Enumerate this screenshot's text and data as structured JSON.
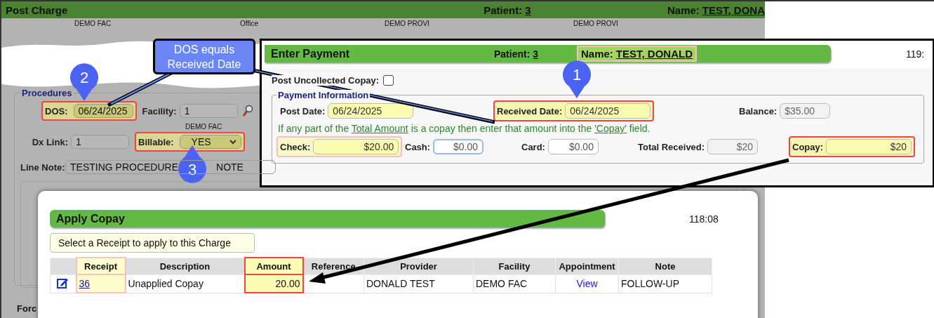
{
  "post_charge": {
    "title": "Post Charge",
    "patient_label": "Patient:",
    "patient": "3",
    "name_label": "Name:",
    "name": "TEST, DONA",
    "top_labels": [
      "DEMO FAC",
      "Office",
      "DEMO PROVI",
      "DEMO PROVI"
    ],
    "procedures": {
      "legend": "Procedures",
      "dos": {
        "label": "DOS:",
        "value": "06/24/2025",
        "highlighted": true
      },
      "facility": {
        "label": "Facility:",
        "value": "1"
      },
      "facility_name": "DEMO FAC",
      "dx_link": {
        "label": "Dx Link:",
        "value": "1"
      },
      "billable": {
        "label": "Billable:",
        "value": "YES",
        "highlighted": true
      },
      "line_note": {
        "label": "Line Note:",
        "value": "TESTING PROCEDURE",
        "value_after_marker": "NOTE"
      }
    },
    "footer_label": "Forc"
  },
  "enter_payment": {
    "title": "Enter Payment",
    "patient_label": "Patient:",
    "patient": "3",
    "name_label": "Name:",
    "name": "TEST, DONALD",
    "name_soft_highlighted": true,
    "timer": "119:",
    "uncollected": {
      "label": "Post Uncollected Copay:",
      "checked": false
    },
    "legend": "Payment Information",
    "row1": [
      {
        "label": "Post Date:",
        "value": "06/24/2025",
        "required": true
      },
      {
        "label": "Received Date:",
        "value": "06/24/2025",
        "required": true,
        "highlighted": true
      },
      {
        "label": "Balance:",
        "value": "$35.00",
        "disabled": true
      }
    ],
    "message": [
      {
        "kind": "text",
        "text": "If any part of the "
      },
      {
        "kind": "link",
        "text": "Total Amount"
      },
      {
        "kind": "text",
        "text": " is a copay then enter that amount into the "
      },
      {
        "kind": "link",
        "text": "'Copay'"
      },
      {
        "kind": "text",
        "text": " field."
      }
    ],
    "row2": [
      {
        "label": "Check:",
        "value": "$20.00",
        "required": true,
        "soft_highlighted": true
      },
      {
        "label": "Cash:",
        "value": "$0.00",
        "focused": true
      },
      {
        "label": "Card:",
        "value": "$0.00"
      },
      {
        "label": "Total Received:",
        "value": "$20",
        "disabled": true
      },
      {
        "label": "Copay:",
        "value": "$20",
        "required": true,
        "highlighted": true
      }
    ]
  },
  "apply_copay": {
    "title": "Apply Copay",
    "timer": "118:08",
    "select_button": "Select a Receipt to apply to this Charge",
    "columns": [
      {
        "label": "Receipt",
        "soft_highlighted": true
      },
      {
        "label": "Description"
      },
      {
        "label": "Amount",
        "highlighted": true
      },
      {
        "label": "Reference"
      },
      {
        "label": "Provider"
      },
      {
        "label": "Facility"
      },
      {
        "label": "Appointment"
      },
      {
        "label": "Note"
      }
    ],
    "rows": [
      {
        "receipt": "36",
        "description": "Unapplied Copay",
        "amount": "20.00",
        "provider": "DONALD TEST",
        "facility": "DEMO FAC",
        "appointment": "View",
        "note": "FOLLOW-UP"
      }
    ]
  },
  "callout": {
    "text": "DOS equals Received Date"
  },
  "markers": [
    {
      "label": "1"
    },
    {
      "label": "2"
    },
    {
      "label": "3"
    }
  ]
}
